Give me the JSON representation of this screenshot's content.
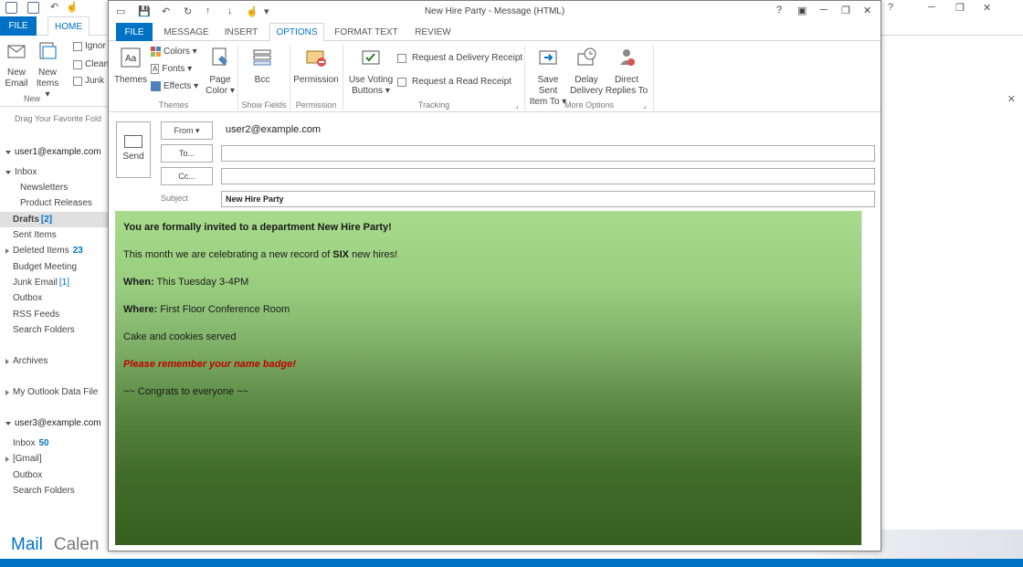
{
  "main": {
    "tabs": {
      "file": "FILE",
      "home": "HOME"
    },
    "ribbon": {
      "new_email": [
        "New",
        "Email"
      ],
      "new_items": [
        "New",
        "Items ▾"
      ],
      "new_group": "New",
      "ignore": "Ignor",
      "clean": "Clean",
      "junk": "Junk"
    },
    "favorites_hint": "Drag Your Favorite Fold",
    "nav": {
      "account1": "user1@example.com",
      "inbox": "Inbox",
      "newsletters": "Newsletters",
      "product_releases": "Product Releases",
      "drafts": "Drafts",
      "drafts_count": "[2]",
      "sent_items": "Sent Items",
      "deleted_items": "Deleted Items",
      "deleted_count": "23",
      "budget_meeting": "Budget Meeting",
      "junk_email": "Junk Email",
      "junk_count": "[1]",
      "outbox": "Outbox",
      "rss_feeds": "RSS Feeds",
      "search_folders": "Search Folders",
      "archives": "Archives",
      "my_outlook_data_file": "My Outlook Data File",
      "account2": "user3@example.com",
      "inbox2": "Inbox",
      "inbox2_count": "50",
      "gmail": "[Gmail]",
      "outbox2": "Outbox",
      "search_folders2": "Search Folders"
    },
    "bottom_nav": {
      "mail": "Mail",
      "calendar": "Calen"
    }
  },
  "message": {
    "title": "New Hire Party - Message (HTML)",
    "tabs": [
      "FILE",
      "MESSAGE",
      "INSERT",
      "OPTIONS",
      "FORMAT TEXT",
      "REVIEW"
    ],
    "active_tab": "OPTIONS",
    "ribbon": {
      "themes": "Themes",
      "colors": "Colors ▾",
      "fonts": "Fonts ▾",
      "effects": "Effects ▾",
      "page_color": [
        "Page",
        "Color ▾"
      ],
      "bcc": "Bcc",
      "permission": "Permission",
      "use_voting": [
        "Use Voting",
        "Buttons ▾"
      ],
      "request_delivery": "Request a Delivery Receipt",
      "request_read": "Request a Read Receipt",
      "save_sent": [
        "Save Sent",
        "Item To ▾"
      ],
      "delay_delivery": [
        "Delay",
        "Delivery"
      ],
      "direct_replies": [
        "Direct",
        "Replies To"
      ],
      "groups": {
        "themes": "Themes",
        "show_fields": "Show Fields",
        "permission": "Permission",
        "tracking": "Tracking",
        "more_options": "More Options"
      }
    },
    "send_label": "Send",
    "from_label": "From ▾",
    "from_value": "user2@example.com",
    "to_label": "To...",
    "cc_label": "Cc...",
    "subject_label": "Subject",
    "subject_value": "New Hire Party",
    "body": {
      "line1": "You are formally invited to a department New Hire Party!",
      "line2_pre": "This month we are celebrating a new record of ",
      "line2_bold": "SIX",
      "line2_post": " new hires!",
      "when_label": "When:",
      "when_value": " This Tuesday 3-4PM",
      "where_label": "Where:",
      "where_value": "  First Floor Conference Room",
      "cake": "Cake and cookies served",
      "badge": "Please remember your name badge!",
      "congrats": "~~ Congrats to everyone  ~~"
    }
  },
  "colors": {
    "accent": "#0072c6",
    "body_top": "#a8db8c",
    "body_bottom": "#365f20",
    "badge_red": "#c00000"
  }
}
